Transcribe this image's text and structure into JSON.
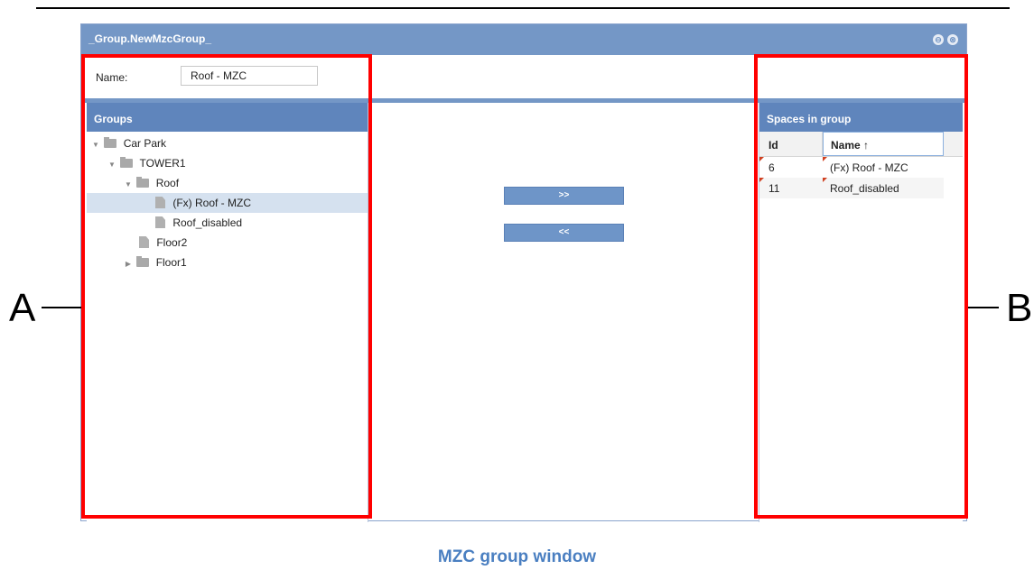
{
  "window": {
    "title": "_Group.NewMzcGroup_",
    "minimize_glyph": "⊖",
    "close_glyph": "⊗"
  },
  "form": {
    "name_label": "Name:",
    "name_value": "Roof - MZC"
  },
  "groups_panel": {
    "header": "Groups",
    "tree": [
      {
        "label": "Car Park",
        "type": "folder",
        "expanded": true
      },
      {
        "label": "TOWER1",
        "type": "folder",
        "expanded": true
      },
      {
        "label": "Roof",
        "type": "folder",
        "expanded": true
      },
      {
        "label": "(Fx) Roof - MZC",
        "type": "file",
        "selected": true
      },
      {
        "label": "Roof_disabled",
        "type": "file"
      },
      {
        "label": "Floor2",
        "type": "file"
      },
      {
        "label": "Floor1",
        "type": "folder",
        "expanded": false
      }
    ]
  },
  "actions": {
    "add_label": ">>",
    "remove_label": "<<"
  },
  "spaces_panel": {
    "header": "Spaces in group",
    "columns": {
      "id": "Id",
      "name": "Name ↑"
    },
    "rows": [
      {
        "id": "6",
        "name": "(Fx) Roof - MZC"
      },
      {
        "id": "11",
        "name": "Roof_disabled"
      }
    ]
  },
  "annotations": {
    "left_letter": "A",
    "right_letter": "B",
    "highlight_color": "#ff0000"
  },
  "caption": "MZC group window",
  "colors": {
    "titlebar": "#7497c6",
    "panel_header": "#5f85bc",
    "caption": "#4a7fc1"
  }
}
